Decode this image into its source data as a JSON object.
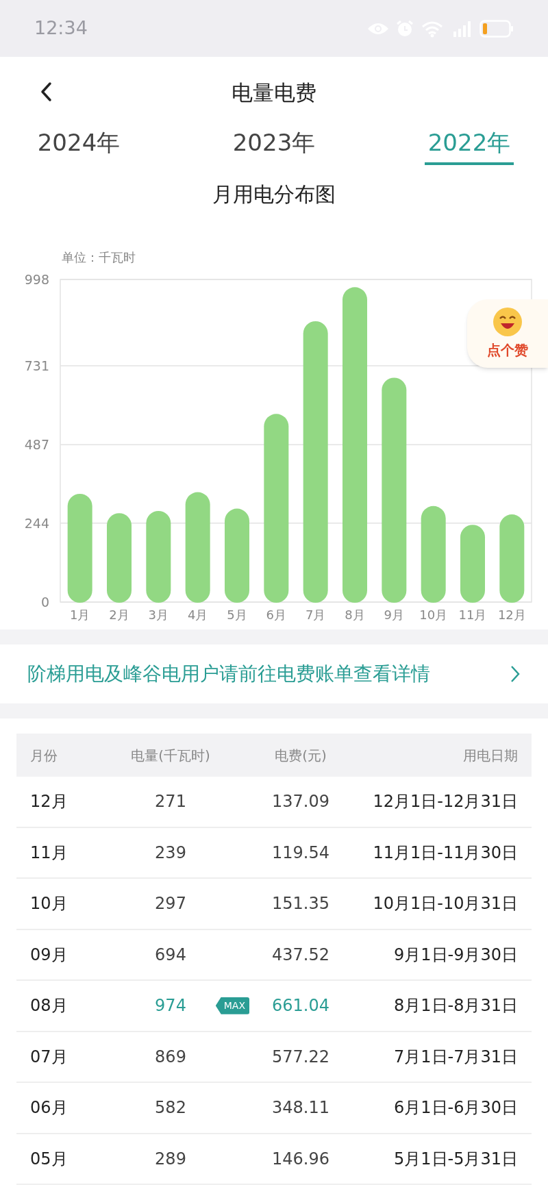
{
  "status_bar": {
    "time": "12:34"
  },
  "header": {
    "title": "电量电费"
  },
  "tabs": [
    {
      "label": "2024年",
      "selected": false
    },
    {
      "label": "2023年",
      "selected": false
    },
    {
      "label": "2022年",
      "selected": true
    }
  ],
  "chart": {
    "title": "月用电分布图",
    "unit": "单位：千瓦时",
    "like_badge": "点个赞",
    "chart_data": {
      "type": "bar",
      "categories": [
        "1月",
        "2月",
        "3月",
        "4月",
        "5月",
        "6月",
        "7月",
        "8月",
        "9月",
        "10月",
        "11月",
        "12月"
      ],
      "grid": true,
      "series": [
        {
          "color": "#92d883",
          "values": [
            335,
            275,
            282,
            340,
            289,
            582,
            869,
            974,
            694,
            297,
            239,
            271
          ]
        }
      ],
      "ylim": [
        0,
        998
      ],
      "yticks": [
        0,
        244,
        487,
        731,
        998
      ]
    }
  },
  "banner": {
    "text": "阶梯用电及峰谷电用户请前往电费账单查看详情"
  },
  "table": {
    "columns": [
      "月份",
      "电量(千瓦时)",
      "电费(元)",
      "用电日期"
    ],
    "max_label": "MAX",
    "rows": [
      {
        "month": "12月",
        "energy": "271",
        "fee": "137.09",
        "period": "12月1日-12月31日",
        "max": false
      },
      {
        "month": "11月",
        "energy": "239",
        "fee": "119.54",
        "period": "11月1日-11月30日",
        "max": false
      },
      {
        "month": "10月",
        "energy": "297",
        "fee": "151.35",
        "period": "10月1日-10月31日",
        "max": false
      },
      {
        "month": "09月",
        "energy": "694",
        "fee": "437.52",
        "period": "9月1日-9月30日",
        "max": false
      },
      {
        "month": "08月",
        "energy": "974",
        "fee": "661.04",
        "period": "8月1日-8月31日",
        "max": true
      },
      {
        "month": "07月",
        "energy": "869",
        "fee": "577.22",
        "period": "7月1日-7月31日",
        "max": false
      },
      {
        "month": "06月",
        "energy": "582",
        "fee": "348.11",
        "period": "6月1日-6月30日",
        "max": false
      },
      {
        "month": "05月",
        "energy": "289",
        "fee": "146.96",
        "period": "5月1日-5月31日",
        "max": false
      }
    ]
  }
}
